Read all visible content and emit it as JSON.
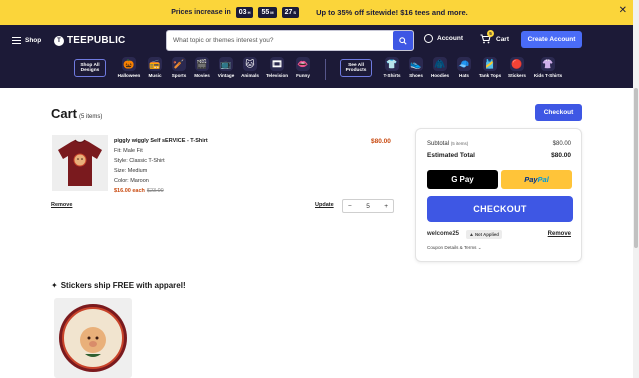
{
  "promo": {
    "prefix": "Prices increase in",
    "hours": "03",
    "hours_unit": "H",
    "minutes": "55",
    "minutes_unit": "M",
    "seconds": "27",
    "seconds_unit": "S",
    "headline": "Up to 35% off sitewide! $16 tees and more."
  },
  "header": {
    "shop_label": "Shop",
    "logo_text": "TEEPUBLIC",
    "search_placeholder": "What topic or themes interest you?",
    "account_label": "Account",
    "cart_label": "Cart",
    "cart_count": "5",
    "create_account_label": "Create Account"
  },
  "nav": {
    "shop_all_designs": "Shop All Designs",
    "categories": [
      {
        "label": "Halloween",
        "icon": "pumpkin-icon"
      },
      {
        "label": "Music",
        "icon": "music-icon"
      },
      {
        "label": "Sports",
        "icon": "sports-icon"
      },
      {
        "label": "Movies",
        "icon": "movies-icon"
      },
      {
        "label": "Vintage",
        "icon": "vintage-icon"
      },
      {
        "label": "Animals",
        "icon": "animals-icon"
      },
      {
        "label": "Television",
        "icon": "television-icon"
      },
      {
        "label": "Funny",
        "icon": "funny-icon"
      }
    ],
    "see_all_products": "See All Products",
    "products": [
      {
        "label": "T-Shirts",
        "icon": "tshirt-icon"
      },
      {
        "label": "Shoes",
        "icon": "shoes-icon",
        "badge": "NEW"
      },
      {
        "label": "Hoodies",
        "icon": "hoodie-icon"
      },
      {
        "label": "Hats",
        "icon": "hat-icon"
      },
      {
        "label": "Tank Tops",
        "icon": "tanktop-icon"
      },
      {
        "label": "Stickers",
        "icon": "sticker-icon"
      },
      {
        "label": "Kids T-Shirts",
        "icon": "kids-tshirt-icon"
      }
    ]
  },
  "cart": {
    "title": "Cart",
    "count_label": "(5 items)",
    "checkout_label": "Checkout",
    "item": {
      "name": "piggly wiggly Self sERVICE - T-Shirt",
      "fit": "Fit: Male Fit",
      "style": "Style: Classic T-Shirt",
      "size": "Size: Medium",
      "color": "Color: Maroon",
      "sale_price": "$16.00 each",
      "original_price": "$23.00",
      "line_total": "$80.00",
      "quantity": "5",
      "remove_label": "Remove",
      "update_label": "Update",
      "minus": "−",
      "plus": "+"
    }
  },
  "summary": {
    "subtotal_label": "Subtotal",
    "subtotal_items": "(5 items)",
    "subtotal_value": "$80.00",
    "estimated_label": "Estimated Total",
    "estimated_value": "$80.00",
    "gpay_label": "Pay",
    "paypal_pay": "Pay",
    "paypal_pal": "Pal",
    "checkout_label": "CHECKOUT",
    "promo_code": "welcome25",
    "not_applied": "Not Applied",
    "promo_remove": "Remove",
    "coupon_terms": "Coupon Details & Terms"
  },
  "stickers": {
    "title": "Stickers ship FREE with apparel!"
  },
  "colors": {
    "brand_dark": "#1c1a37",
    "promo_yellow": "#fbd53a",
    "accent_blue": "#3e57e4",
    "sale_orange": "#c94a10",
    "maroon": "#7a1a1e"
  }
}
